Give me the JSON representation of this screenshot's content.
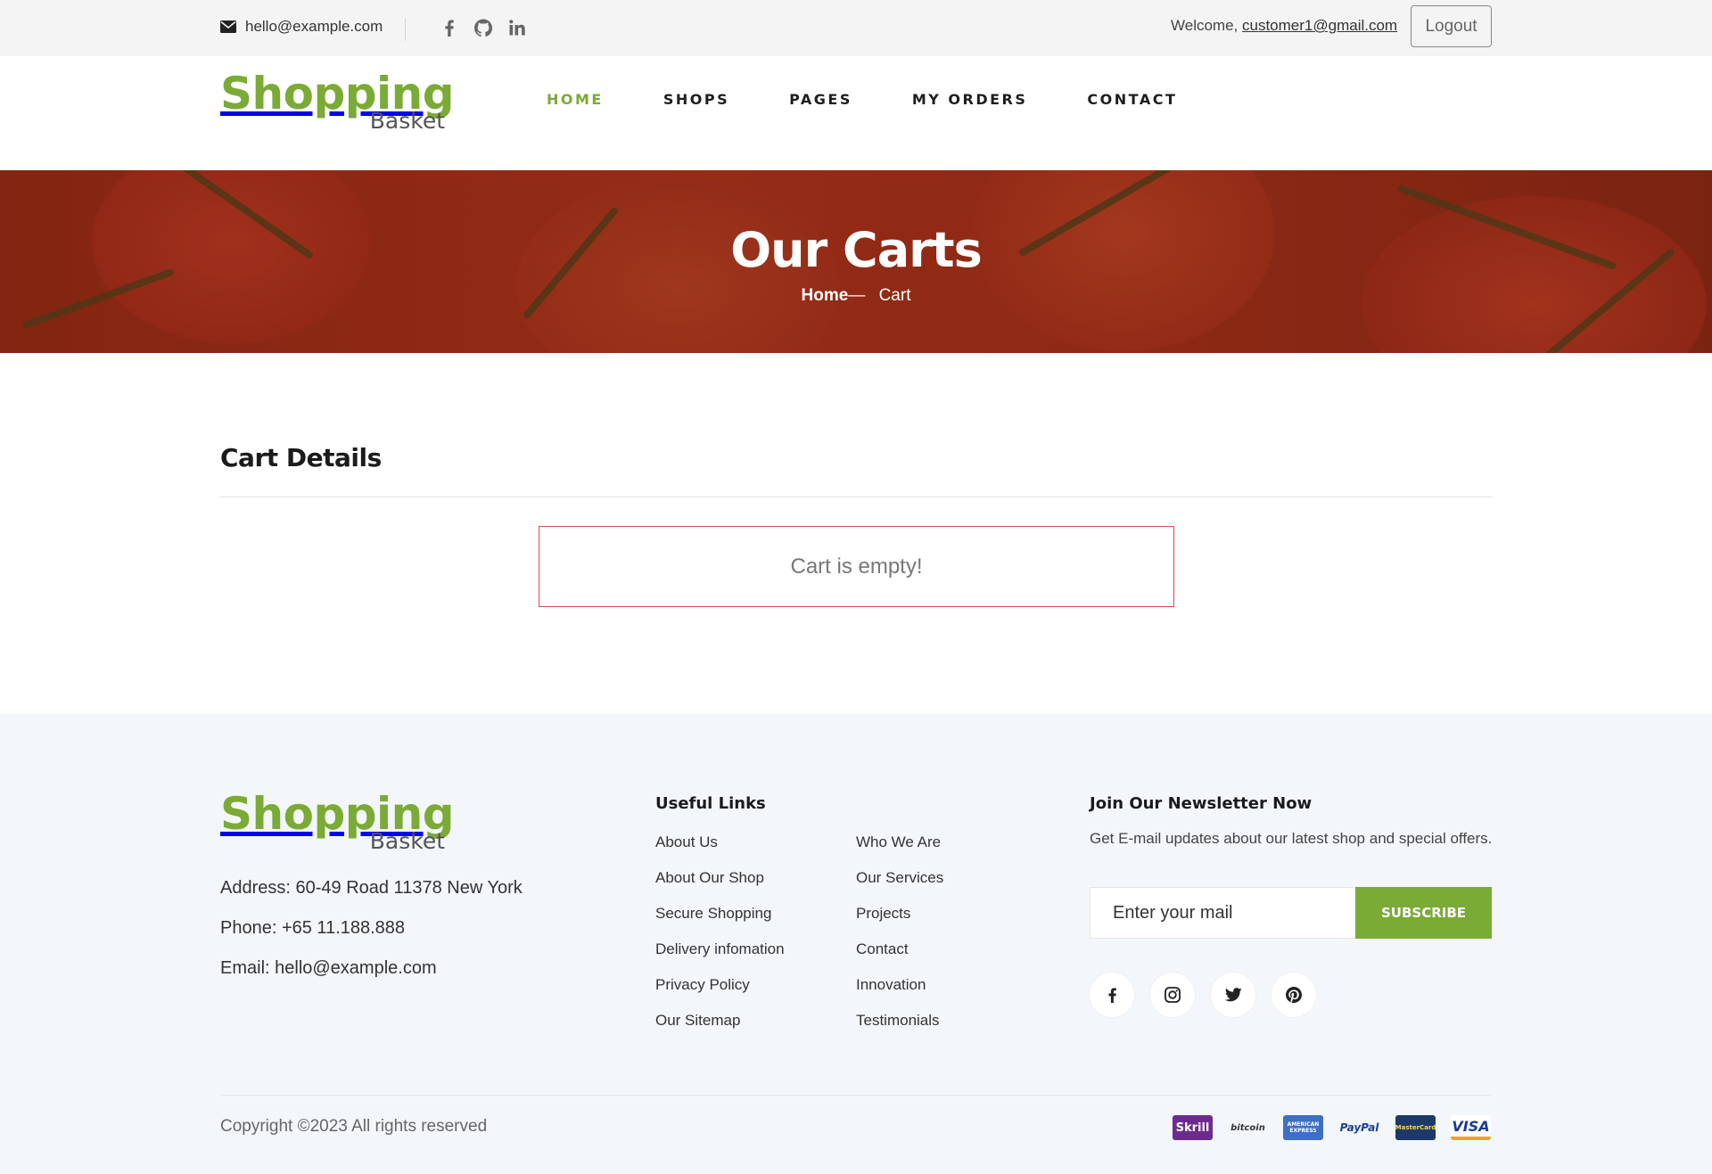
{
  "topbar": {
    "email": "hello@example.com",
    "welcome_prefix": "Welcome, ",
    "user_email": "customer1@gmail.com",
    "logout_label": "Logout"
  },
  "logo": {
    "line1": "Shopping",
    "line2": "Basket"
  },
  "nav": [
    "HOME",
    "SHOPS",
    "PAGES",
    "MY ORDERS",
    "CONTACT"
  ],
  "banner": {
    "title": "Our Carts",
    "crumb_home": "Home",
    "crumb_sep": "— ",
    "crumb_current": "Cart"
  },
  "cart": {
    "title": "Cart Details",
    "empty_message": "Cart is empty!"
  },
  "footer": {
    "address": "Address: 60-49 Road 11378 New York",
    "phone": "Phone: +65 11.188.888",
    "email": "Email: hello@example.com",
    "links_heading": "Useful Links",
    "links_col1": [
      "About Us",
      "About Our Shop",
      "Secure Shopping",
      "Delivery infomation",
      "Privacy Policy",
      "Our Sitemap"
    ],
    "links_col2": [
      "Who We Are",
      "Our Services",
      "Projects",
      "Contact",
      "Innovation",
      "Testimonials"
    ],
    "newsletter_heading": "Join Our Newsletter Now",
    "newsletter_text": "Get E-mail updates about our latest shop and special offers.",
    "newsletter_placeholder": "Enter your mail",
    "subscribe_label": "SUBSCRIBE",
    "copyright": "Copyright ©2023 All rights reserved",
    "payments": [
      "Skrill",
      "bitcoin",
      "AMERICAN EXPRESS",
      "PayPal",
      "MasterCard",
      "VISA"
    ]
  },
  "colors": {
    "brand": "#7aab35",
    "error_border": "#e0465a",
    "footer_bg": "#f3f6fa"
  }
}
